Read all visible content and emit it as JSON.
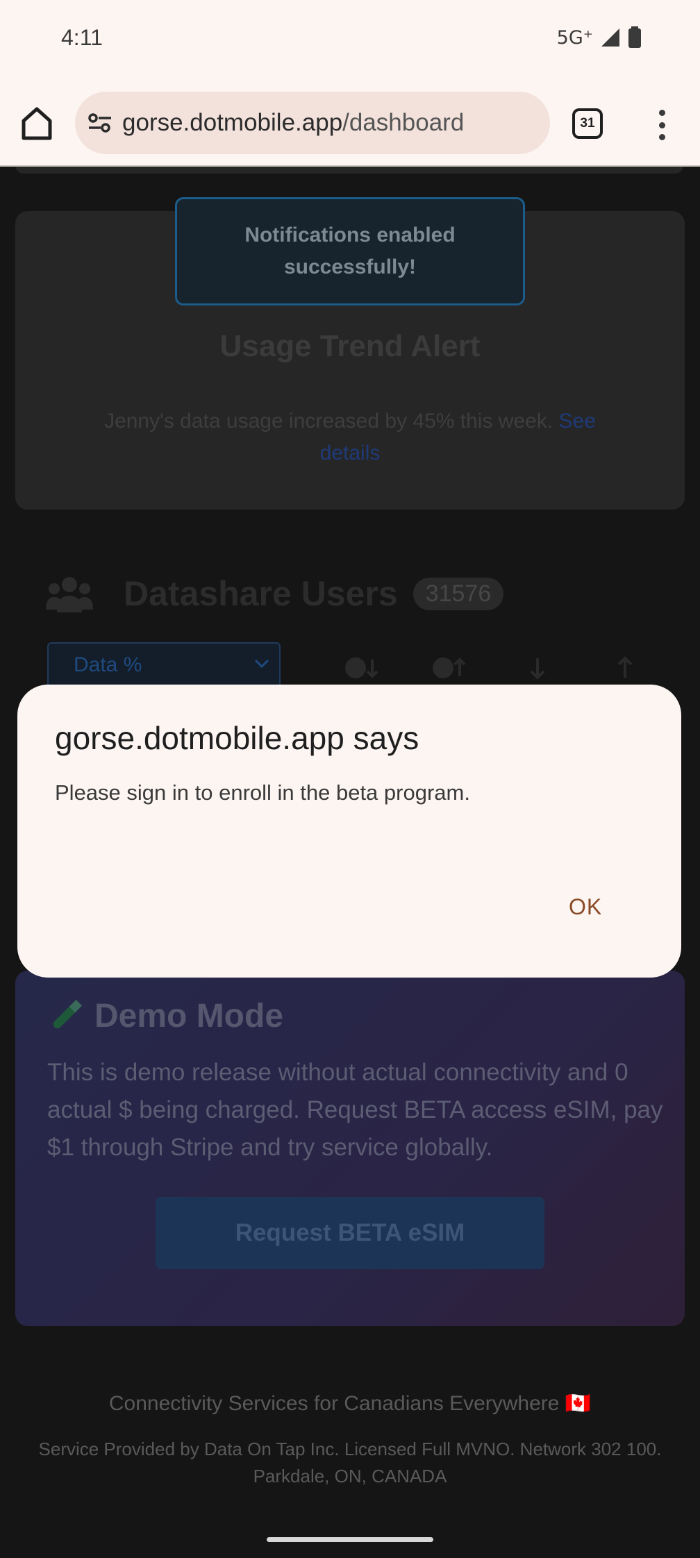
{
  "status_bar": {
    "time": "4:11",
    "network": "5G⁺"
  },
  "browser": {
    "url_domain": "gorse.dotmobile.app",
    "url_path": "/dashboard",
    "tab_count": "31"
  },
  "page": {
    "toast": "Notifications enabled successfully!",
    "alert": {
      "title": "Usage Trend Alert",
      "body": "Jenny's data usage increased by 45% this week.",
      "link": "See details"
    },
    "datashare": {
      "title": "Datashare Users",
      "count": "31576",
      "select_value": "Data %"
    },
    "demo": {
      "title": "Demo Mode",
      "text": "This is demo release without actual connectivity and 0 actual $ being charged. Request BETA access eSIM, pay $1 through Stripe and try service globally.",
      "button": "Request BETA eSIM"
    },
    "footer": {
      "tagline": "Connectivity Services for Canadians Everywhere 🇨🇦",
      "legal": "Service Provided by Data On Tap Inc. Licensed Full MVNO. Network 302 100. Parkdale, ON, CANADA"
    }
  },
  "dialog": {
    "title": "gorse.dotmobile.app says",
    "message": "Please sign in to enroll in the beta program.",
    "ok": "OK"
  },
  "colors": {
    "dialog_bg": "#fdf5f2",
    "ok_text": "#8a4a26",
    "toast_border": "#1c5c8a"
  }
}
